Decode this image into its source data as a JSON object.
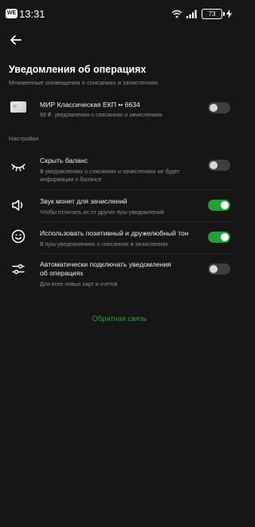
{
  "status_bar": {
    "badge": "WE",
    "time": "13:31",
    "battery": "73"
  },
  "header": {
    "title": "Уведомления об операциях",
    "subtitle": "Мгновенные оповещения о списаниях и зачислениях"
  },
  "card": {
    "title": "МИР Классическая ЕКП •• 6634",
    "subtitle": "99 ₽, уведомления о списаниях и зачислениях",
    "enabled": false
  },
  "settings": {
    "label": "Настройки",
    "items": [
      {
        "icon": "closed-eye-icon",
        "title": "Скрыть баланс",
        "subtitle_lines": [
          "В уведомлениях о списаниях и зачислениях не будет",
          "информации о балансе"
        ],
        "enabled": false
      },
      {
        "icon": "speaker-icon",
        "title": "Звук монет для зачислений",
        "subtitle_lines": [
          "Чтобы отличать их от других пуш-уведомлений"
        ],
        "enabled": true
      },
      {
        "icon": "smiley-icon",
        "title": "Использовать позитивный и дружелюбный тон",
        "subtitle_lines": [
          "В пуш-уведомлениях о списаниях и зачислениях"
        ],
        "enabled": true
      },
      {
        "icon": "sliders-icon",
        "title_lines": [
          "Автоматически подключать уведомления",
          "об операциях"
        ],
        "subtitle_lines": [
          "Для всех новых карт и счетов"
        ],
        "enabled": false
      }
    ]
  },
  "feedback_label": "Обратная связь",
  "colors": {
    "background": "#161616",
    "accent": "#21a038",
    "muted_text": "#8c8c8c"
  }
}
